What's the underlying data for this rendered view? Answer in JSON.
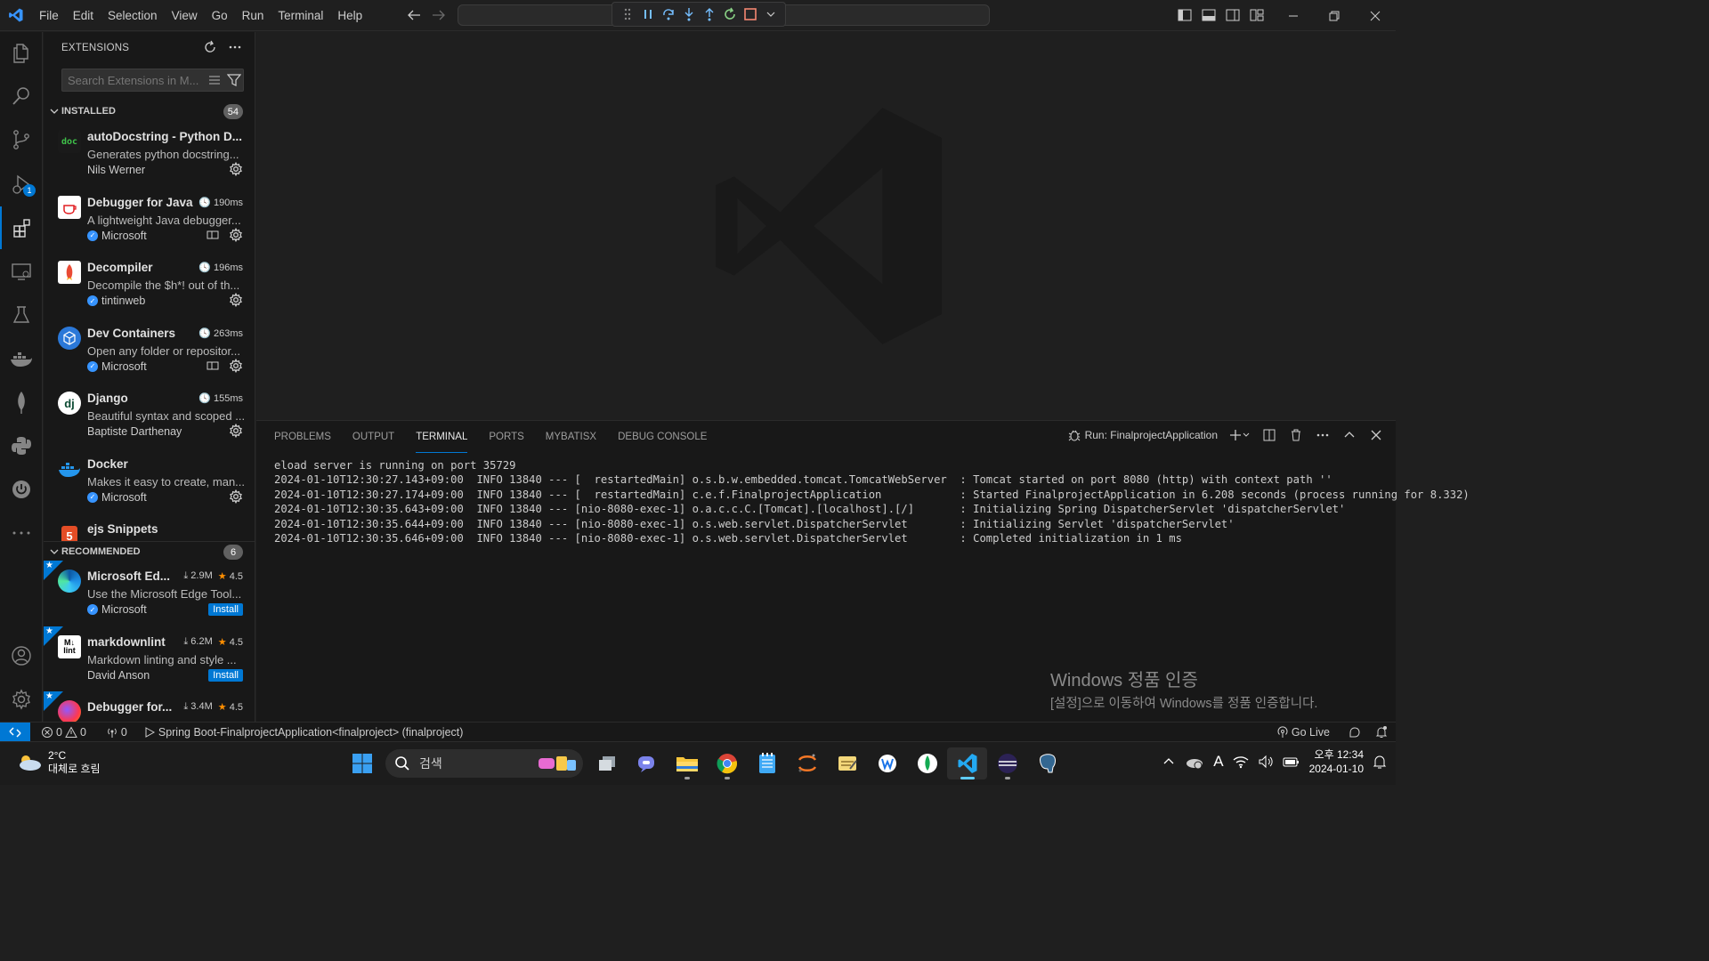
{
  "menu": [
    "File",
    "Edit",
    "Selection",
    "View",
    "Go",
    "Run",
    "Terminal",
    "Help"
  ],
  "sidebar": {
    "title": "EXTENSIONS",
    "search_placeholder": "Search Extensions in M...",
    "installed": {
      "label": "INSTALLED",
      "count": "54",
      "items": [
        {
          "name": "autoDocstring - Python D...",
          "desc": "Generates python docstring...",
          "publisher": "Nils Werner",
          "verified": false,
          "time": "",
          "icon": "doc-icon"
        },
        {
          "name": "Debugger for Java",
          "desc": "A lightweight Java debugger...",
          "publisher": "Microsoft",
          "verified": true,
          "time": "190ms",
          "icon": "java-icon"
        },
        {
          "name": "Decompiler",
          "desc": "Decompile the $h*! out of th...",
          "publisher": "tintinweb",
          "verified": true,
          "time": "196ms",
          "icon": "rocket-icon"
        },
        {
          "name": "Dev Containers",
          "desc": "Open any folder or repositor...",
          "publisher": "Microsoft",
          "verified": true,
          "time": "263ms",
          "icon": "container-icon"
        },
        {
          "name": "Django",
          "desc": "Beautiful syntax and scoped ...",
          "publisher": "Baptiste Darthenay",
          "verified": false,
          "time": "155ms",
          "icon": "django-icon"
        },
        {
          "name": "Docker",
          "desc": "Makes it easy to create, man...",
          "publisher": "Microsoft",
          "verified": true,
          "time": "",
          "icon": "docker-icon"
        },
        {
          "name": "ejs Snippets",
          "desc": "",
          "publisher": "",
          "verified": false,
          "time": "",
          "icon": "html5-icon"
        }
      ]
    },
    "recommended": {
      "label": "RECOMMENDED",
      "count": "6",
      "items": [
        {
          "name": "Microsoft Ed...",
          "desc": "Use the Microsoft Edge Tool...",
          "publisher": "Microsoft",
          "verified": true,
          "downloads": "2.9M",
          "rating": "4.5",
          "install": "Install"
        },
        {
          "name": "markdownlint",
          "desc": "Markdown linting and style ...",
          "publisher": "David Anson",
          "verified": false,
          "downloads": "6.2M",
          "rating": "4.5",
          "install": "Install"
        },
        {
          "name": "Debugger for...",
          "desc": "",
          "publisher": "",
          "verified": false,
          "downloads": "3.4M",
          "rating": "4.5",
          "install": ""
        }
      ]
    }
  },
  "panel": {
    "tabs": [
      "PROBLEMS",
      "OUTPUT",
      "TERMINAL",
      "PORTS",
      "MYBATISX",
      "DEBUG CONSOLE"
    ],
    "active_tab": "TERMINAL",
    "run_label": "Run: FinalprojectApplication",
    "terminal_lines": [
      "eload server is running on port 35729",
      "2024-01-10T12:30:27.143+09:00  INFO 13840 --- [  restartedMain] o.s.b.w.embedded.tomcat.TomcatWebServer  : Tomcat started on port 8080 (http) with context path ''",
      "2024-01-10T12:30:27.174+09:00  INFO 13840 --- [  restartedMain] c.e.f.FinalprojectApplication            : Started FinalprojectApplication in 6.208 seconds (process running for 8.332)",
      "2024-01-10T12:30:35.643+09:00  INFO 13840 --- [nio-8080-exec-1] o.a.c.c.C.[Tomcat].[localhost].[/]       : Initializing Spring DispatcherServlet 'dispatcherServlet'",
      "2024-01-10T12:30:35.644+09:00  INFO 13840 --- [nio-8080-exec-1] o.s.web.servlet.DispatcherServlet        : Initializing Servlet 'dispatcherServlet'",
      "2024-01-10T12:30:35.646+09:00  INFO 13840 --- [nio-8080-exec-1] o.s.web.servlet.DispatcherServlet        : Completed initialization in 1 ms"
    ]
  },
  "watermark": {
    "line1": "Windows 정품 인증",
    "line2": "[설정]으로 이동하여 Windows를 정품 인증합니다."
  },
  "statusbar": {
    "errors": "0",
    "warnings": "0",
    "ports": "0",
    "run_config": "Spring Boot-FinalprojectApplication<finalproject> (finalproject)",
    "go_live": "Go Live"
  },
  "taskbar": {
    "temp": "2°C",
    "weather": "대체로 흐림",
    "search_placeholder": "검색",
    "time": "오후 12:34",
    "date": "2024-01-10"
  },
  "colors": {
    "accent": "#0078d4",
    "background": "#1f1f1f",
    "sidebar_bg": "#181818"
  }
}
